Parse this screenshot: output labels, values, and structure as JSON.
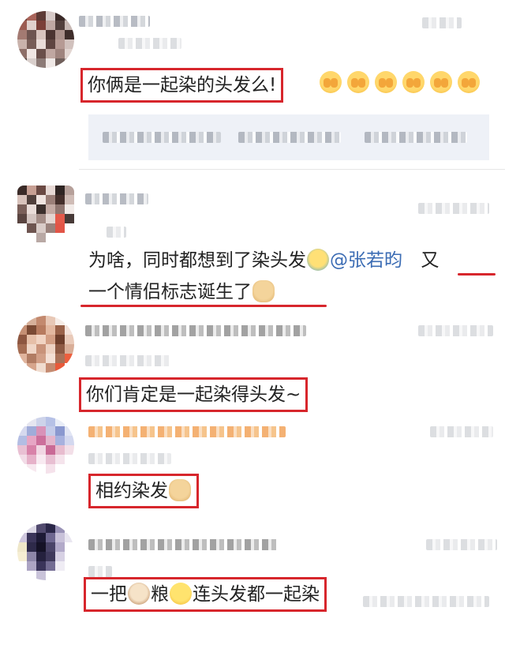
{
  "comments": [
    {
      "id": "c1",
      "text": "你俩是一起染的头发么!",
      "reactions": [
        "face-cover-icon",
        "face-cover-icon",
        "face-cover-icon",
        "face-cover-icon",
        "face-cover-icon",
        "face-cover-icon"
      ]
    },
    {
      "id": "c2",
      "line1_prefix": "为啥，同时都想到了染头发",
      "mention": "@张若昀",
      "line1_suffix": "又",
      "line2": "一个情侣标志诞生了"
    },
    {
      "id": "c3",
      "text": "你们肯定是一起染得头发~"
    },
    {
      "id": "c4",
      "text": "相约染发"
    },
    {
      "id": "c5",
      "part1": "一把",
      "part2": "粮",
      "part3": "连头发都一起染"
    }
  ],
  "colors": {
    "highlight_red": "#d7262c",
    "mention_blue": "#3b6cb4",
    "quote_bg": "#eef1f7"
  }
}
